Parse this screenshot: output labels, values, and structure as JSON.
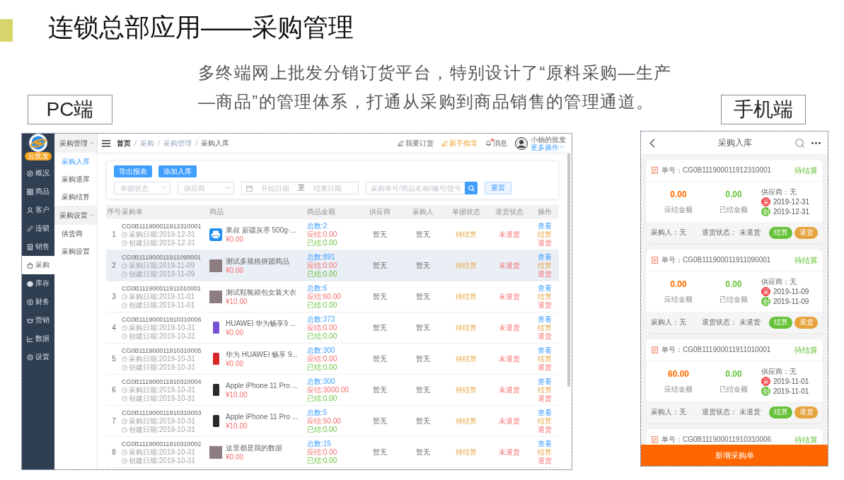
{
  "slide": {
    "title": "连锁总部应用——采购管理",
    "description": "多终端网上批发分销订货平台，特别设计了“原料采购—生产—商品”的管理体系，打通从采购到商品销售的管理通道。",
    "pc_label": "PC端",
    "mobile_label": "手机端"
  },
  "pc_app": {
    "brand_badge": "云批发",
    "nav": [
      {
        "label": "概况",
        "selected": false
      },
      {
        "label": "商品",
        "selected": false
      },
      {
        "label": "客户",
        "selected": false
      },
      {
        "label": "连锁",
        "selected": false
      },
      {
        "label": "销售",
        "selected": false
      },
      {
        "label": "采购",
        "selected": true
      },
      {
        "label": "库存",
        "selected": false
      },
      {
        "label": "财务",
        "selected": false
      },
      {
        "label": "营销",
        "selected": false
      },
      {
        "label": "数据",
        "selected": false
      },
      {
        "label": "设置",
        "selected": false
      }
    ],
    "submenu": [
      {
        "label": "采购管理",
        "expanded": true,
        "children": [
          {
            "label": "采购入库",
            "selected": true
          },
          {
            "label": "采购退库",
            "selected": false
          },
          {
            "label": "采购结算",
            "selected": false
          }
        ]
      },
      {
        "label": "采购设置",
        "expanded": true,
        "children": [
          {
            "label": "供货商",
            "selected": false
          },
          {
            "label": "采购设置",
            "selected": false
          }
        ]
      }
    ],
    "breadcrumb": [
      {
        "kind": "home",
        "label": "首页"
      },
      {
        "kind": "link",
        "label": "采购"
      },
      {
        "kind": "link",
        "label": "采购管理"
      },
      {
        "kind": "current",
        "label": "采购入库"
      }
    ],
    "header_links": [
      {
        "kind": "order",
        "label": "我要订货",
        "unread": false
      },
      {
        "kind": "guide",
        "label": "新手指导",
        "unread": false
      },
      {
        "kind": "message",
        "label": "消息",
        "unread": true
      }
    ],
    "user": {
      "name": "小杨的批发",
      "menu": "更多操作"
    },
    "actions": [
      "导出报表",
      "添加入库"
    ],
    "filters": {
      "status_placeholder": "单据状态",
      "supplier_placeholder": "供应商",
      "start_placeholder": "开始日期",
      "range_separator": "至",
      "end_placeholder": "结束日期",
      "search_placeholder": "采购单号/商品名称/编号/货号",
      "reset": "重置"
    },
    "table": {
      "columns": [
        "序号",
        "采购单",
        "商品",
        "商品金额",
        "供应商",
        "采购人",
        "单据状态",
        "退货状态",
        "操作"
      ],
      "rows": [
        {
          "index": "1",
          "highlighted": false,
          "order_no": "CG0B111900011912310001",
          "purchase_date": "采购日期:2019-12-31",
          "create_date": "创建日期:2019-12-31",
          "thumb": {
            "kind": "icon"
          },
          "product": "果叔 新疆灰枣 500g·...",
          "price": "¥0.00",
          "total": "总数:2",
          "payable": "应结:0.00",
          "paid": "已结:0.00",
          "supplier": "暂无",
          "buyer": "暂无",
          "doc_status": "待结算",
          "return_status": "未退货",
          "ops": [
            {
              "kind": "view",
              "label": "查看"
            },
            {
              "kind": "settle",
              "label": "结算"
            },
            {
              "kind": "return",
              "label": "退货"
            }
          ]
        },
        {
          "index": "2",
          "highlighted": true,
          "order_no": "CG0B111900011911090001",
          "purchase_date": "采购日期:2019-11-09",
          "create_date": "创建日期:2019-11-09",
          "thumb": {
            "kind": "photo"
          },
          "product": "测试多规格拼团商品",
          "price": "¥0.00",
          "total": "总数:891",
          "payable": "应结:0.00",
          "paid": "已结:0.00",
          "supplier": "暂无",
          "buyer": "暂无",
          "doc_status": "待结算",
          "return_status": "未退货",
          "ops": [
            {
              "kind": "view",
              "label": "查看"
            },
            {
              "kind": "settle",
              "label": "结算"
            },
            {
              "kind": "return",
              "label": "退货"
            }
          ]
        },
        {
          "index": "3",
          "highlighted": false,
          "order_no": "CG0B111900011911010001",
          "purchase_date": "采购日期:2019-11-01",
          "create_date": "创建日期:2019-11-01",
          "thumb": {
            "kind": "photo"
          },
          "product": "测试鞋靴箱包女装大衣",
          "price": "¥10.00",
          "total": "总数:6",
          "payable": "应结:60.00",
          "paid": "已结:0.00",
          "supplier": "暂无",
          "buyer": "暂无",
          "doc_status": "待结算",
          "return_status": "未退货",
          "ops": [
            {
              "kind": "view",
              "label": "查看"
            },
            {
              "kind": "settle",
              "label": "结算"
            },
            {
              "kind": "return",
              "label": "退货"
            }
          ]
        },
        {
          "index": "4",
          "highlighted": false,
          "order_no": "CG0B111900011910310006",
          "purchase_date": "采购日期:2019-10-31",
          "create_date": "创建日期:2019-10-31",
          "thumb": {
            "kind": "device",
            "color": "#7b4fd6"
          },
          "product": "HUAWEI 华为畅享9 ...",
          "price": "¥0.00",
          "total": "总数:372",
          "payable": "应结:0.00",
          "paid": "已结:0.00",
          "supplier": "暂无",
          "buyer": "暂无",
          "doc_status": "待结算",
          "return_status": "未退货",
          "ops": [
            {
              "kind": "view",
              "label": "查看"
            },
            {
              "kind": "settle",
              "label": "结算"
            },
            {
              "kind": "return",
              "label": "退货"
            }
          ]
        },
        {
          "index": "5",
          "highlighted": false,
          "order_no": "CG0B111900011910310005",
          "purchase_date": "采购日期:2019-10-31",
          "create_date": "创建日期:2019-10-31",
          "thumb": {
            "kind": "device",
            "color": "#d9262b"
          },
          "product": "华为 HUAWEI 畅享 9...",
          "price": "¥0.00",
          "total": "总数:300",
          "payable": "应结:0.00",
          "paid": "已结:0.00",
          "supplier": "暂无",
          "buyer": "暂无",
          "doc_status": "待结算",
          "return_status": "未退货",
          "ops": [
            {
              "kind": "view",
              "label": "查看"
            },
            {
              "kind": "settle",
              "label": "结算"
            },
            {
              "kind": "return",
              "label": "退货"
            }
          ]
        },
        {
          "index": "6",
          "highlighted": false,
          "order_no": "CG0B111900011910310004",
          "purchase_date": "采购日期:2019-10-31",
          "create_date": "创建日期:2019-10-31",
          "thumb": {
            "kind": "device",
            "color": "#2a2a2a"
          },
          "product": "Apple iPhone 11 Pro ...",
          "price": "¥10.00",
          "total": "总数:300",
          "payable": "应结:3000.00",
          "paid": "已结:0.00",
          "supplier": "暂无",
          "buyer": "暂无",
          "doc_status": "待结算",
          "return_status": "未退货",
          "ops": [
            {
              "kind": "view",
              "label": "查看"
            },
            {
              "kind": "settle",
              "label": "结算"
            },
            {
              "kind": "return",
              "label": "退货"
            }
          ]
        },
        {
          "index": "7",
          "highlighted": false,
          "order_no": "CG0B111900011910310003",
          "purchase_date": "采购日期:2019-10-31",
          "create_date": "创建日期:2019-10-31",
          "thumb": {
            "kind": "device",
            "color": "#2a2a2a"
          },
          "product": "Apple iPhone 11 Pro ...",
          "price": "¥10.00",
          "total": "总数:5",
          "payable": "应结:50.00",
          "paid": "已结:0.00",
          "supplier": "暂无",
          "buyer": "暂无",
          "doc_status": "待结算",
          "return_status": "未退货",
          "ops": [
            {
              "kind": "view",
              "label": "查看"
            },
            {
              "kind": "settle",
              "label": "结算"
            },
            {
              "kind": "return",
              "label": "退货"
            }
          ]
        },
        {
          "index": "8",
          "highlighted": false,
          "order_no": "CG0B111900011910310002",
          "purchase_date": "采购日期:2019-10-31",
          "create_date": "创建日期:2019-10-31",
          "thumb": {
            "kind": "photo"
          },
          "product": "这里都是我的数据",
          "price": "¥0.00",
          "total": "总数:15",
          "payable": "应结:0.00",
          "paid": "已结:0.00",
          "supplier": "暂无",
          "buyer": "暂无",
          "doc_status": "待结算",
          "return_status": "未退货",
          "ops": [
            {
              "kind": "view",
              "label": "查看"
            },
            {
              "kind": "settle",
              "label": "结算"
            },
            {
              "kind": "return",
              "label": "退货"
            }
          ]
        }
      ]
    }
  },
  "mobile_app": {
    "title": "采购入库",
    "orders": [
      {
        "order_no": "单号：CG0B111900011912310001",
        "status": "待结算",
        "payable": "0.00",
        "payable_label": "应结金额",
        "paid": "0.00",
        "paid_label": "已结金额",
        "supplier": "供应商：无",
        "purchase_badge": "采",
        "purchase_date": "2019-12-31",
        "create_badge": "创",
        "create_date": "2019-12-31",
        "buyer": "采购人：无",
        "return_status": "退货状态： 未退货",
        "buttons": [
          {
            "kind": "settle",
            "label": "结算"
          },
          {
            "kind": "return",
            "label": "退货"
          }
        ]
      },
      {
        "order_no": "单号：CG0B111900011911090001",
        "status": "待结算",
        "payable": "0.00",
        "payable_label": "应结金额",
        "paid": "0.00",
        "paid_label": "已结金额",
        "supplier": "供应商：无",
        "purchase_badge": "采",
        "purchase_date": "2019-11-09",
        "create_badge": "创",
        "create_date": "2019-11-09",
        "buyer": "采购人：无",
        "return_status": "退货状态： 未退货",
        "buttons": [
          {
            "kind": "settle",
            "label": "结算"
          },
          {
            "kind": "return",
            "label": "退货"
          }
        ]
      },
      {
        "order_no": "单号：CG0B111900011911010001",
        "status": "待结算",
        "payable": "60.00",
        "payable_label": "应结金额",
        "paid": "0.00",
        "paid_label": "已结金额",
        "supplier": "供应商：无",
        "purchase_badge": "采",
        "purchase_date": "2019-11-01",
        "create_badge": "创",
        "create_date": "2019-11-01",
        "buyer": "采购人：无",
        "return_status": "退货状态： 未退货",
        "buttons": [
          {
            "kind": "settle",
            "label": "结算"
          },
          {
            "kind": "return",
            "label": "退货"
          }
        ]
      },
      {
        "order_no": "单号：CG0B111900011910310006",
        "status": "待结算"
      }
    ],
    "add_button": "新增采购单"
  }
}
